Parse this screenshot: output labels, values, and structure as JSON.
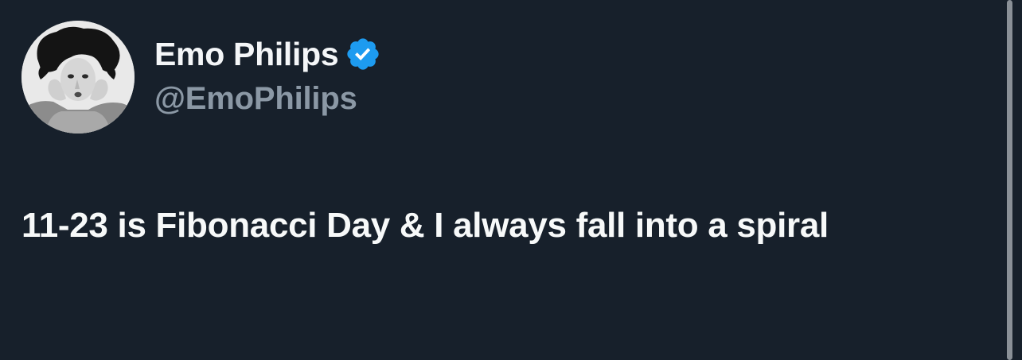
{
  "tweet": {
    "author": {
      "display_name": "Emo Philips",
      "handle": "@EmoPhilips",
      "verified": true,
      "verified_icon": "verified-badge-icon",
      "avatar_icon": "profile-photo"
    },
    "text": "11-23 is Fibonacci Day & I always fall into a spiral"
  },
  "colors": {
    "background": "#17202b",
    "primary_text": "#f7f9f9",
    "secondary_text": "#8b98a5",
    "verified_blue": "#1d9bf0"
  }
}
